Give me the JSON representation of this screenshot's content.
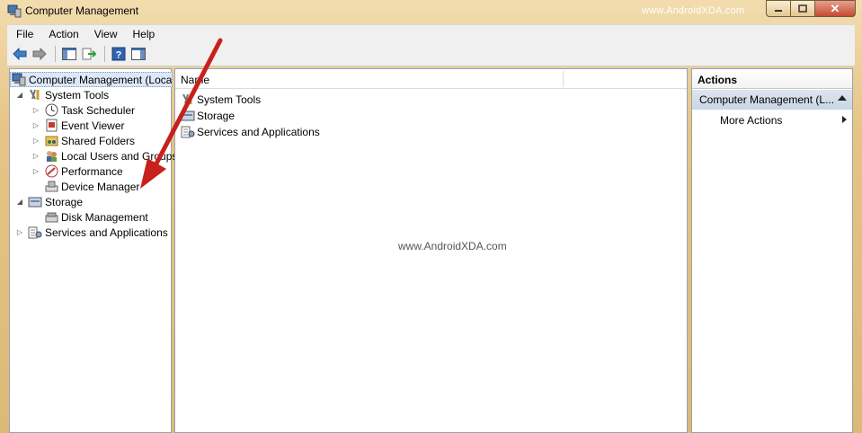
{
  "window": {
    "title": "Computer Management",
    "watermark": "www.AndroidXDA.com"
  },
  "menu": [
    "File",
    "Action",
    "View",
    "Help"
  ],
  "tree": {
    "root": "Computer Management (Local",
    "items": [
      {
        "label": "System Tools",
        "level": 1,
        "expander": "expanded",
        "icon": "tools-icon"
      },
      {
        "label": "Task Scheduler",
        "level": 2,
        "expander": "collapsed",
        "icon": "clock-icon"
      },
      {
        "label": "Event Viewer",
        "level": 2,
        "expander": "collapsed",
        "icon": "event-viewer-icon"
      },
      {
        "label": "Shared Folders",
        "level": 2,
        "expander": "collapsed",
        "icon": "shared-folder-icon"
      },
      {
        "label": "Local Users and Groups",
        "level": 2,
        "expander": "collapsed",
        "icon": "users-icon"
      },
      {
        "label": "Performance",
        "level": 2,
        "expander": "collapsed",
        "icon": "performance-icon"
      },
      {
        "label": "Device Manager",
        "level": 2,
        "expander": "none",
        "icon": "device-manager-icon"
      },
      {
        "label": "Storage",
        "level": 1,
        "expander": "expanded",
        "icon": "storage-icon"
      },
      {
        "label": "Disk Management",
        "level": 2,
        "expander": "none",
        "icon": "disk-icon"
      },
      {
        "label": "Services and Applications",
        "level": 1,
        "expander": "collapsed",
        "icon": "services-icon"
      }
    ]
  },
  "list": {
    "column_name": "Name",
    "rows": [
      "System Tools",
      "Storage",
      "Services and Applications"
    ],
    "watermark": "www.AndroidXDA.com"
  },
  "actions": {
    "header": "Actions",
    "group": "Computer Management (L...",
    "items": [
      "More Actions"
    ]
  }
}
